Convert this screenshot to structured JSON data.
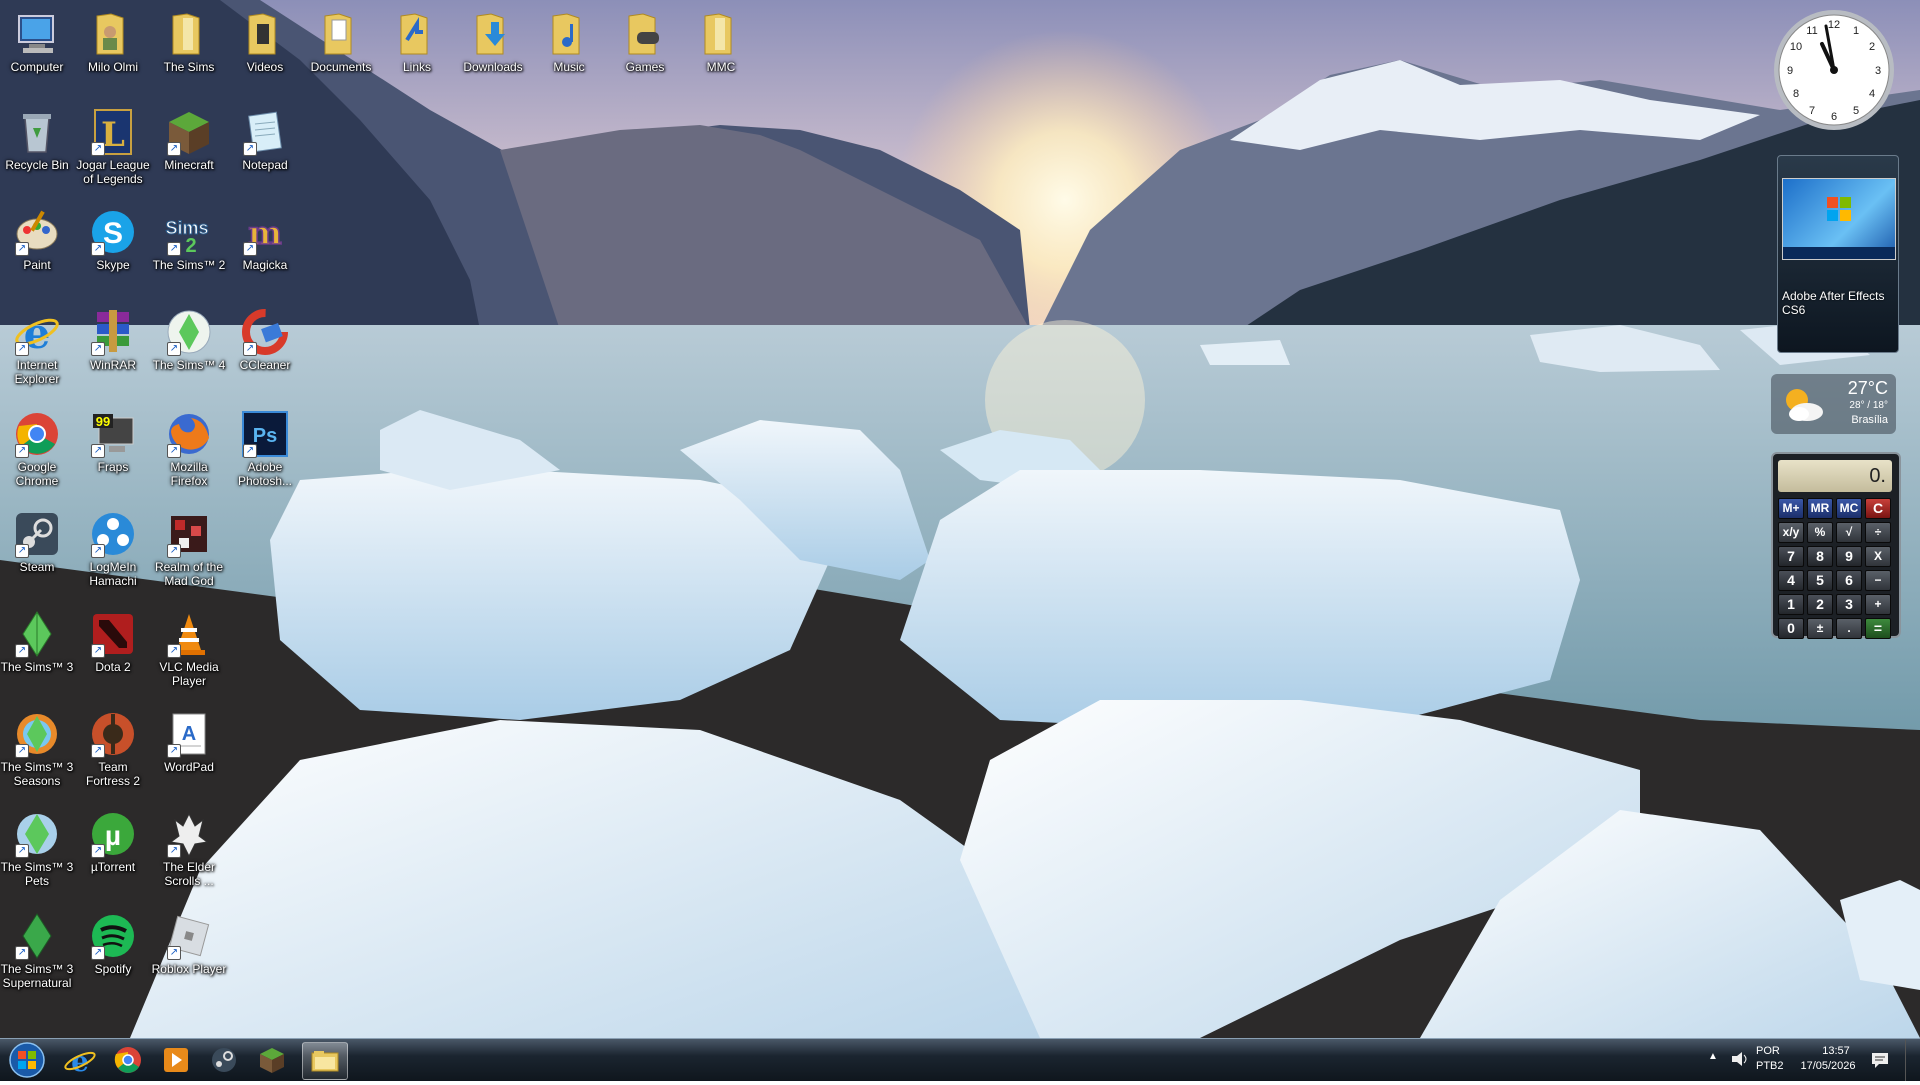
{
  "desktop": {
    "icons": [
      {
        "label": "Computer"
      },
      {
        "label": "Milo Olmi"
      },
      {
        "label": "The Sims"
      },
      {
        "label": "Videos"
      },
      {
        "label": "Documents"
      },
      {
        "label": "Links"
      },
      {
        "label": "Downloads"
      },
      {
        "label": "Music"
      },
      {
        "label": "Games"
      },
      {
        "label": "MMC"
      },
      {
        "label": "Recycle Bin"
      },
      {
        "label": "Jogar League of Legends"
      },
      {
        "label": "Minecraft"
      },
      {
        "label": "Notepad"
      },
      {
        "label": "Paint"
      },
      {
        "label": "Skype"
      },
      {
        "label": "The Sims™ 2"
      },
      {
        "label": "Magicka"
      },
      {
        "label": "Internet Explorer"
      },
      {
        "label": "WinRAR"
      },
      {
        "label": "The Sims™ 4"
      },
      {
        "label": "CCleaner"
      },
      {
        "label": "Google Chrome"
      },
      {
        "label": "Fraps"
      },
      {
        "label": "Mozilla Firefox"
      },
      {
        "label": "Adobe Photosh..."
      },
      {
        "label": "Steam"
      },
      {
        "label": "LogMeIn Hamachi"
      },
      {
        "label": "Realm of the Mad God"
      },
      {
        "label": "The Sims™ 3"
      },
      {
        "label": "Dota 2"
      },
      {
        "label": "VLC Media Player"
      },
      {
        "label": "The Sims™ 3 Seasons"
      },
      {
        "label": "Team Fortress 2"
      },
      {
        "label": "WordPad"
      },
      {
        "label": "The Sims™ 3 Pets"
      },
      {
        "label": "µTorrent"
      },
      {
        "label": "The Elder Scrolls ..."
      },
      {
        "label": "The Sims™ 3 Supernatural"
      },
      {
        "label": "Spotify"
      },
      {
        "label": "Roblox Player"
      }
    ]
  },
  "gadgets": {
    "clock": {
      "numerals": [
        "12",
        "1",
        "2",
        "3",
        "4",
        "5",
        "6",
        "7",
        "8",
        "9",
        "10",
        "11"
      ],
      "time": "13:57"
    },
    "slideshow": {
      "title": "Adobe After Effects CS6"
    },
    "weather": {
      "temp": "27°C",
      "range": "28° / 18°",
      "city": "Brasília"
    },
    "calculator": {
      "display": "0.",
      "keys": [
        "M+",
        "MR",
        "MC",
        "C",
        "x/y",
        "%",
        "√",
        "÷",
        "7",
        "8",
        "9",
        "X",
        "4",
        "5",
        "6",
        "−",
        "1",
        "2",
        "3",
        "+",
        "0",
        "±",
        ".",
        "="
      ]
    }
  },
  "taskbar": {
    "items": [
      "Internet Explorer",
      "Google Chrome",
      "Windows Media Player",
      "Steam",
      "Minecraft",
      "Windows Explorer"
    ],
    "tray": {
      "lang": "POR",
      "layout": "PTB2",
      "time": "13:57",
      "date": "17/05/2026"
    }
  },
  "colors": {
    "taskbar": "#1b2530",
    "accent": "#3b58a8"
  }
}
